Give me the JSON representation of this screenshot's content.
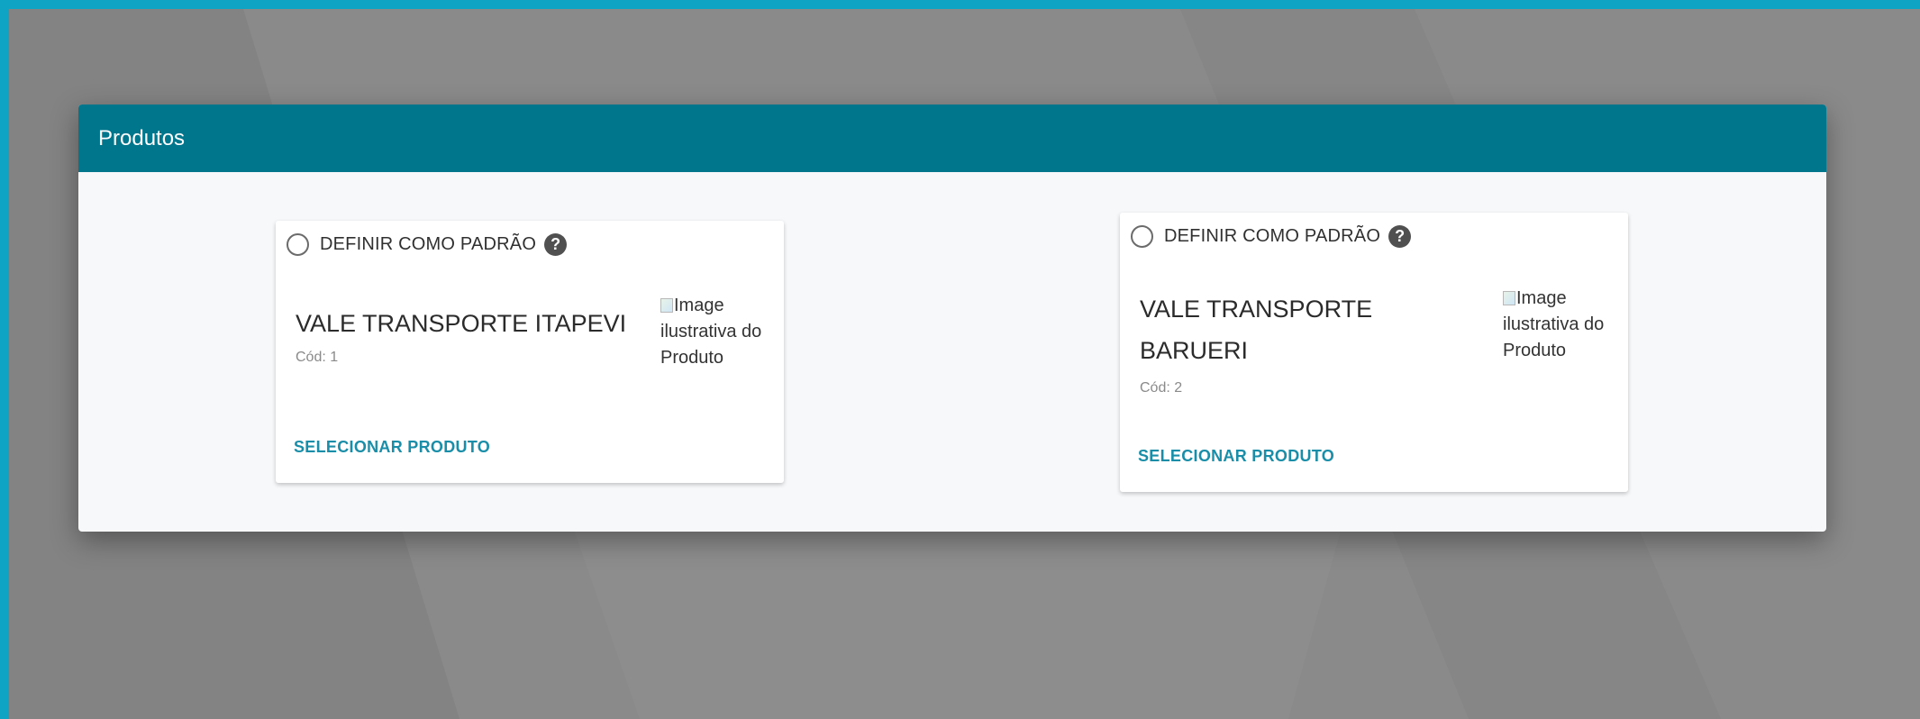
{
  "colors": {
    "frame": "#0fa3c4",
    "backdrop": "#8a8a8a",
    "header": "#00768d",
    "link": "#1a8ea8"
  },
  "dialog": {
    "title": "Produtos"
  },
  "products": [
    {
      "default_label": "DEFINIR COMO PADRÃO",
      "help_icon": "?",
      "name": "VALE TRANSPORTE ITAPEVI",
      "code": "Cód: 1",
      "image_alt": "Image ilustrativa do Produto",
      "image_icon": "broken-image-icon",
      "action_label": "SELECIONAR PRODUTO",
      "default_selected": false
    },
    {
      "default_label": "DEFINIR COMO PADRÃO",
      "help_icon": "?",
      "name": "VALE TRANSPORTE BARUERI",
      "code": "Cód: 2",
      "image_alt": "Image ilustrativa do Produto",
      "image_icon": "broken-image-icon",
      "action_label": "SELECIONAR PRODUTO",
      "default_selected": false
    }
  ]
}
